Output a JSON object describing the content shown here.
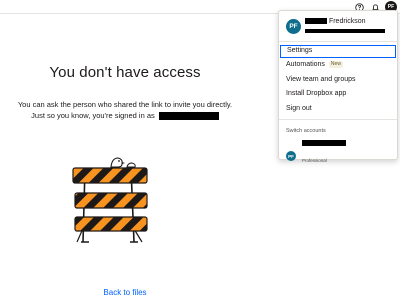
{
  "header": {
    "help_icon": "help-icon",
    "notifications_icon": "bell-icon",
    "avatar_initials": "PF"
  },
  "main": {
    "title": "You don't have access",
    "line1": "You can ask the person who shared the link to invite you directly.",
    "line2": "Just so you know, you're signed in as",
    "back_link": "Back to files"
  },
  "account_menu": {
    "avatar_initials": "PF",
    "user_name_suffix": "Fredrickson",
    "items": [
      {
        "label": "Settings",
        "active": true
      },
      {
        "label": "Automations",
        "badge": "New"
      },
      {
        "label": "View team and groups"
      },
      {
        "label": "Install Dropbox app"
      },
      {
        "label": "Sign out"
      }
    ],
    "switch_accounts_label": "Switch accounts",
    "account": {
      "avatar_initials": "PF",
      "plan": "Professional"
    }
  },
  "colors": {
    "accent": "#0061fe",
    "barricade_orange": "#f7931e",
    "barricade_black": "#1e1919"
  }
}
